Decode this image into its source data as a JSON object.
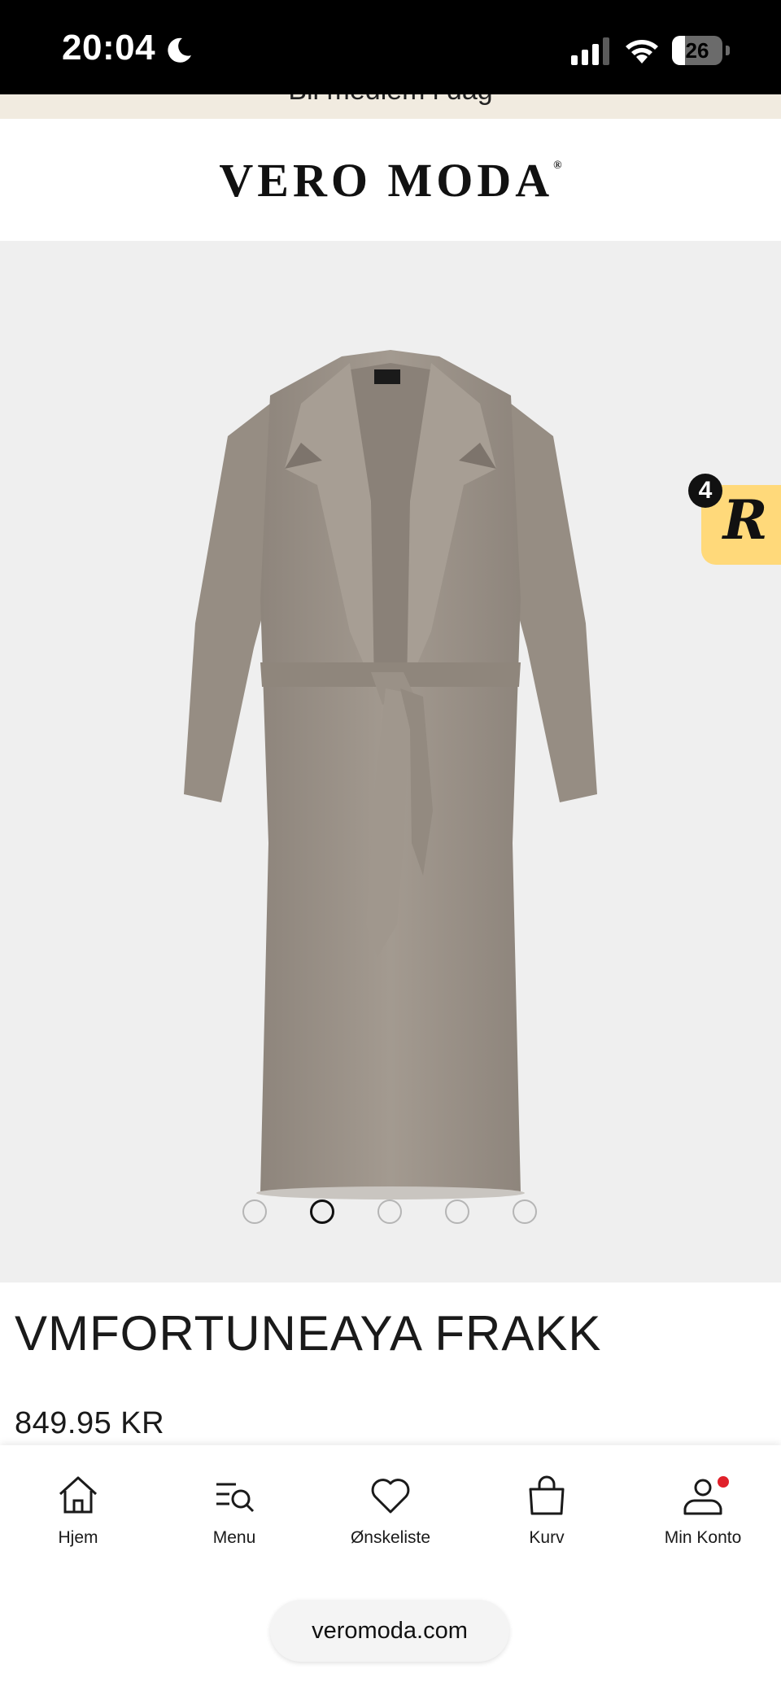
{
  "status_bar": {
    "time": "20:04",
    "battery_percent": 26,
    "battery_label": "26",
    "icons": [
      "moon-icon",
      "signal-icon",
      "wifi-icon",
      "battery-icon"
    ]
  },
  "promo": {
    "text": "Bli medlem i dag"
  },
  "header": {
    "logo_text": "VERO MODA",
    "logo_mark": "®"
  },
  "gallery": {
    "image_alt": "coat-product-image",
    "slide_count": 5,
    "active_slide": 2
  },
  "rewards": {
    "badge_count": "4",
    "letter": "R",
    "color": "#ffd97a"
  },
  "product": {
    "name": "VMFORTUNEAYA FRAKK",
    "price": "849.95 KR"
  },
  "bottom_nav": {
    "items": [
      {
        "label": "Hjem",
        "icon": "home-icon"
      },
      {
        "label": "Menu",
        "icon": "menu-search-icon"
      },
      {
        "label": "Ønskeliste",
        "icon": "heart-icon"
      },
      {
        "label": "Kurv",
        "icon": "bag-icon"
      },
      {
        "label": "Min Konto",
        "icon": "account-icon"
      }
    ]
  },
  "browser": {
    "url": "veromoda.com"
  }
}
